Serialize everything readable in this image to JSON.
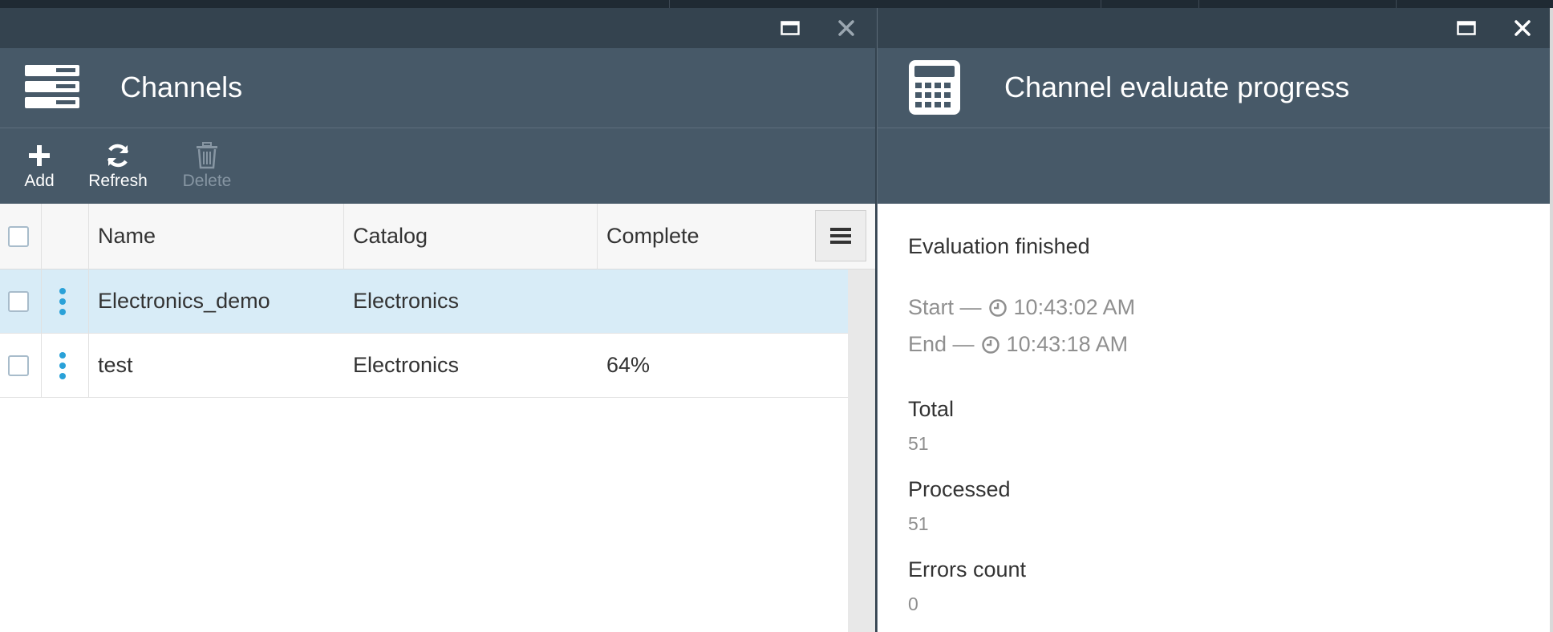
{
  "left_blade": {
    "title": "Channels",
    "icon": "server-stack-icon",
    "toolbar": {
      "add_label": "Add",
      "refresh_label": "Refresh",
      "delete_label": "Delete"
    },
    "grid": {
      "columns": [
        "Name",
        "Catalog",
        "Complete"
      ],
      "rows": [
        {
          "name": "Electronics_demo",
          "catalog": "Electronics",
          "complete": "",
          "selected": true
        },
        {
          "name": "test",
          "catalog": "Electronics",
          "complete": "64%",
          "selected": false
        }
      ]
    }
  },
  "right_blade": {
    "title": "Channel evaluate progress",
    "icon": "calculator-icon",
    "status": "Evaluation finished",
    "start_label": "Start —",
    "start_time": "10:43:02 AM",
    "end_label": "End —",
    "end_time": "10:43:18 AM",
    "total_label": "Total",
    "total_value": "51",
    "processed_label": "Processed",
    "processed_value": "51",
    "errors_label": "Errors count",
    "errors_value": "0"
  },
  "colors": {
    "window_bar": "#34434f",
    "header": "#475968",
    "accent": "#2aa1d8",
    "selected_row": "#d8ecf7"
  }
}
